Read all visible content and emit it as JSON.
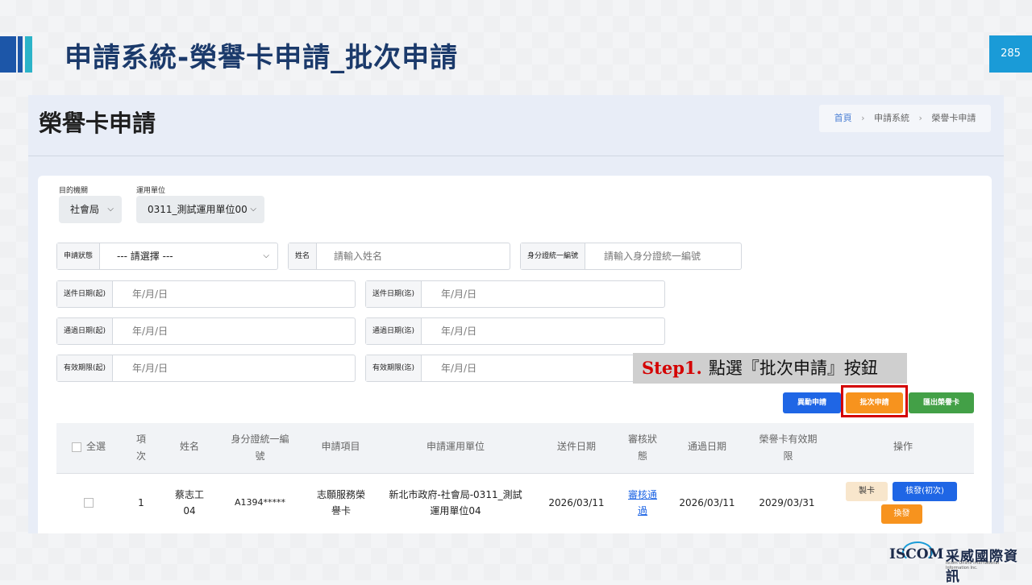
{
  "slide": {
    "title": "申請系統-榮譽卡申請_批次申請",
    "page_number": "285",
    "accent_color": "#1c56a8",
    "accent_color_2": "#2bb3c8"
  },
  "app": {
    "page_title": "榮譽卡申請",
    "breadcrumb": [
      "首頁",
      "申請系統",
      "榮譽卡申請"
    ]
  },
  "filters": {
    "agency_label": "目的機關",
    "agency_value": "社會局",
    "unit_label": "運用單位",
    "unit_value": "0311_測試運用單位00",
    "status_label": "申請狀態",
    "status_value": "--- 請選擇 ---",
    "name_label": "姓名",
    "name_placeholder": "請輸入姓名",
    "id_label": "身分證統一編號",
    "id_placeholder": "請輸入身分證統一編號",
    "submit_start_label": "送件日期(起)",
    "submit_start_value": "年/月/日",
    "submit_end_label": "送件日期(迄)",
    "submit_end_value": "年/月/日",
    "pass_start_label": "通過日期(起)",
    "pass_start_value": "年/月/日",
    "pass_end_label": "通過日期(迄)",
    "pass_end_value": "年/月/日",
    "valid_start_label": "有效期限(起)",
    "valid_start_value": "年/月/日",
    "valid_end_label": "有效期限(迄)",
    "valid_end_value": "年/月/日"
  },
  "actions": {
    "change_apply": "異動申請",
    "batch_apply": "批次申請",
    "export": "匯出榮譽卡"
  },
  "callout": {
    "step": "Step1.",
    "text": "點選『批次申請』按鈕"
  },
  "table": {
    "headers": {
      "select_all": "全選",
      "index_1": "項",
      "index_2": "次",
      "name": "姓名",
      "id_1": "身分證統一編",
      "id_2": "號",
      "item": "申請項目",
      "unit": "申請運用單位",
      "submit_date": "送件日期",
      "review_1": "審核狀",
      "review_2": "態",
      "pass_date": "通過日期",
      "valid_1": "榮譽卡有效期",
      "valid_2": "限",
      "ops": "操作"
    },
    "rows": [
      {
        "index": "1",
        "name_1": "蔡志工",
        "name_2": "04",
        "id": "A1394*****",
        "item_1": "志願服務榮",
        "item_2": "譽卡",
        "unit_1": "新北市政府-社會局-0311_測試",
        "unit_2": "運用單位04",
        "submit_date": "2026/03/11",
        "review_1": "審核通",
        "review_2": "過",
        "pass_date": "2026/03/11",
        "valid": "2029/03/31",
        "op_make": "製卡",
        "op_approve": "核發(初次)",
        "op_reissue": "換發"
      }
    ]
  },
  "footer": {
    "brand": "ISCOM",
    "brand_zh": "采威國際資訊",
    "brand_en": "Iscom Online International Information Inc."
  }
}
